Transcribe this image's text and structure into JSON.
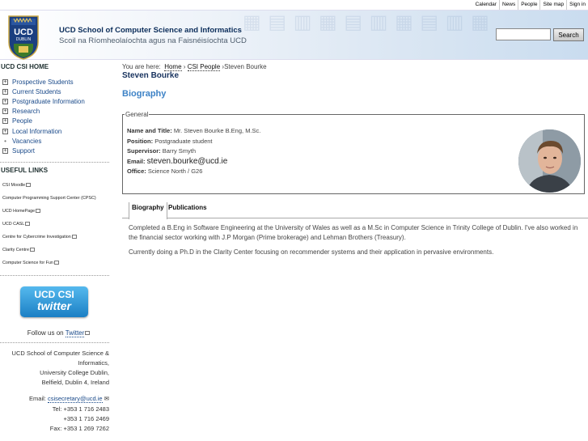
{
  "topbar": {
    "links": [
      "Calendar",
      "News",
      "People",
      "Site map",
      "Sign in"
    ]
  },
  "header": {
    "logo_text": "UCD",
    "logo_sub": "DUBLIN",
    "title": "UCD School of Computer Science and Informatics",
    "subtitle": "Scoil na Ríomheolaíochta agus na Faisnéisíochta UCD",
    "search_placeholder": "",
    "search_button": "Search"
  },
  "sidebar": {
    "heading": "UCD CSI HOME",
    "nav": [
      {
        "label": "Prospective Students",
        "expandable": true
      },
      {
        "label": "Current Students",
        "expandable": true
      },
      {
        "label": "Postgraduate Information",
        "expandable": true
      },
      {
        "label": "Research",
        "expandable": true
      },
      {
        "label": "People",
        "expandable": true
      },
      {
        "label": "Local Information",
        "expandable": true
      },
      {
        "label": "Vacancies",
        "expandable": false
      },
      {
        "label": "Support",
        "expandable": true
      }
    ],
    "useful_heading": "USEFUL LINKS",
    "useful_links": [
      "CSI Moodle",
      "Computer Programming Support Center (CPSC)",
      "UCD HomePage",
      "UCD CASL",
      "Centre for Cybercrime Investigation",
      "Clarity Centre",
      "Computer Science for Fun"
    ],
    "twitter": {
      "line1": "UCD CSI",
      "line2": "twitter"
    },
    "follow_prefix": "Follow us on",
    "follow_link": "Twitter",
    "address": [
      "UCD School of Computer Science &",
      "Informatics,",
      "University College Dublin,",
      "Belfield, Dublin 4, Ireland"
    ],
    "contact": {
      "email_label": "Email:",
      "email": "csisecretary@ucd.ie",
      "tel_label": "Tel:",
      "tel1": "+353 1 716 2483",
      "tel2": "+353 1 716 2469",
      "fax_label": "Fax:",
      "fax": "+353 1 269 7262"
    }
  },
  "breadcrumb": {
    "prefix": "You are here:",
    "home": "Home",
    "people": "CSI People",
    "current": "Steven Bourke"
  },
  "page": {
    "name": "Steven Bourke",
    "section": "Biography",
    "legend": "General",
    "fields": {
      "name_title_label": "Name and Title:",
      "name_title": "Mr. Steven Bourke B.Eng, M.Sc.",
      "position_label": "Position:",
      "position": "Postgraduate student",
      "supervisor_label": "Supervisor:",
      "supervisor": "Barry Smyth",
      "email_label": "Email:",
      "email": "steven.bourke@ucd.ie",
      "office_label": "Office:",
      "office": "Science North / G26"
    },
    "tabs": [
      "Biography",
      "Publications"
    ],
    "bio": [
      "Completed a B.Eng in Software Engineering at the University of Wales as well as a M.Sc in Computer Science in Trinity College of Dublin. I've also worked in the financial sector working with J.P Morgan (Prime brokerage) and Lehman Brothers (Treasury).",
      "Currently doing a Ph.D in the Clarity Center focusing on recommender systems and their application in pervasive environments."
    ]
  }
}
